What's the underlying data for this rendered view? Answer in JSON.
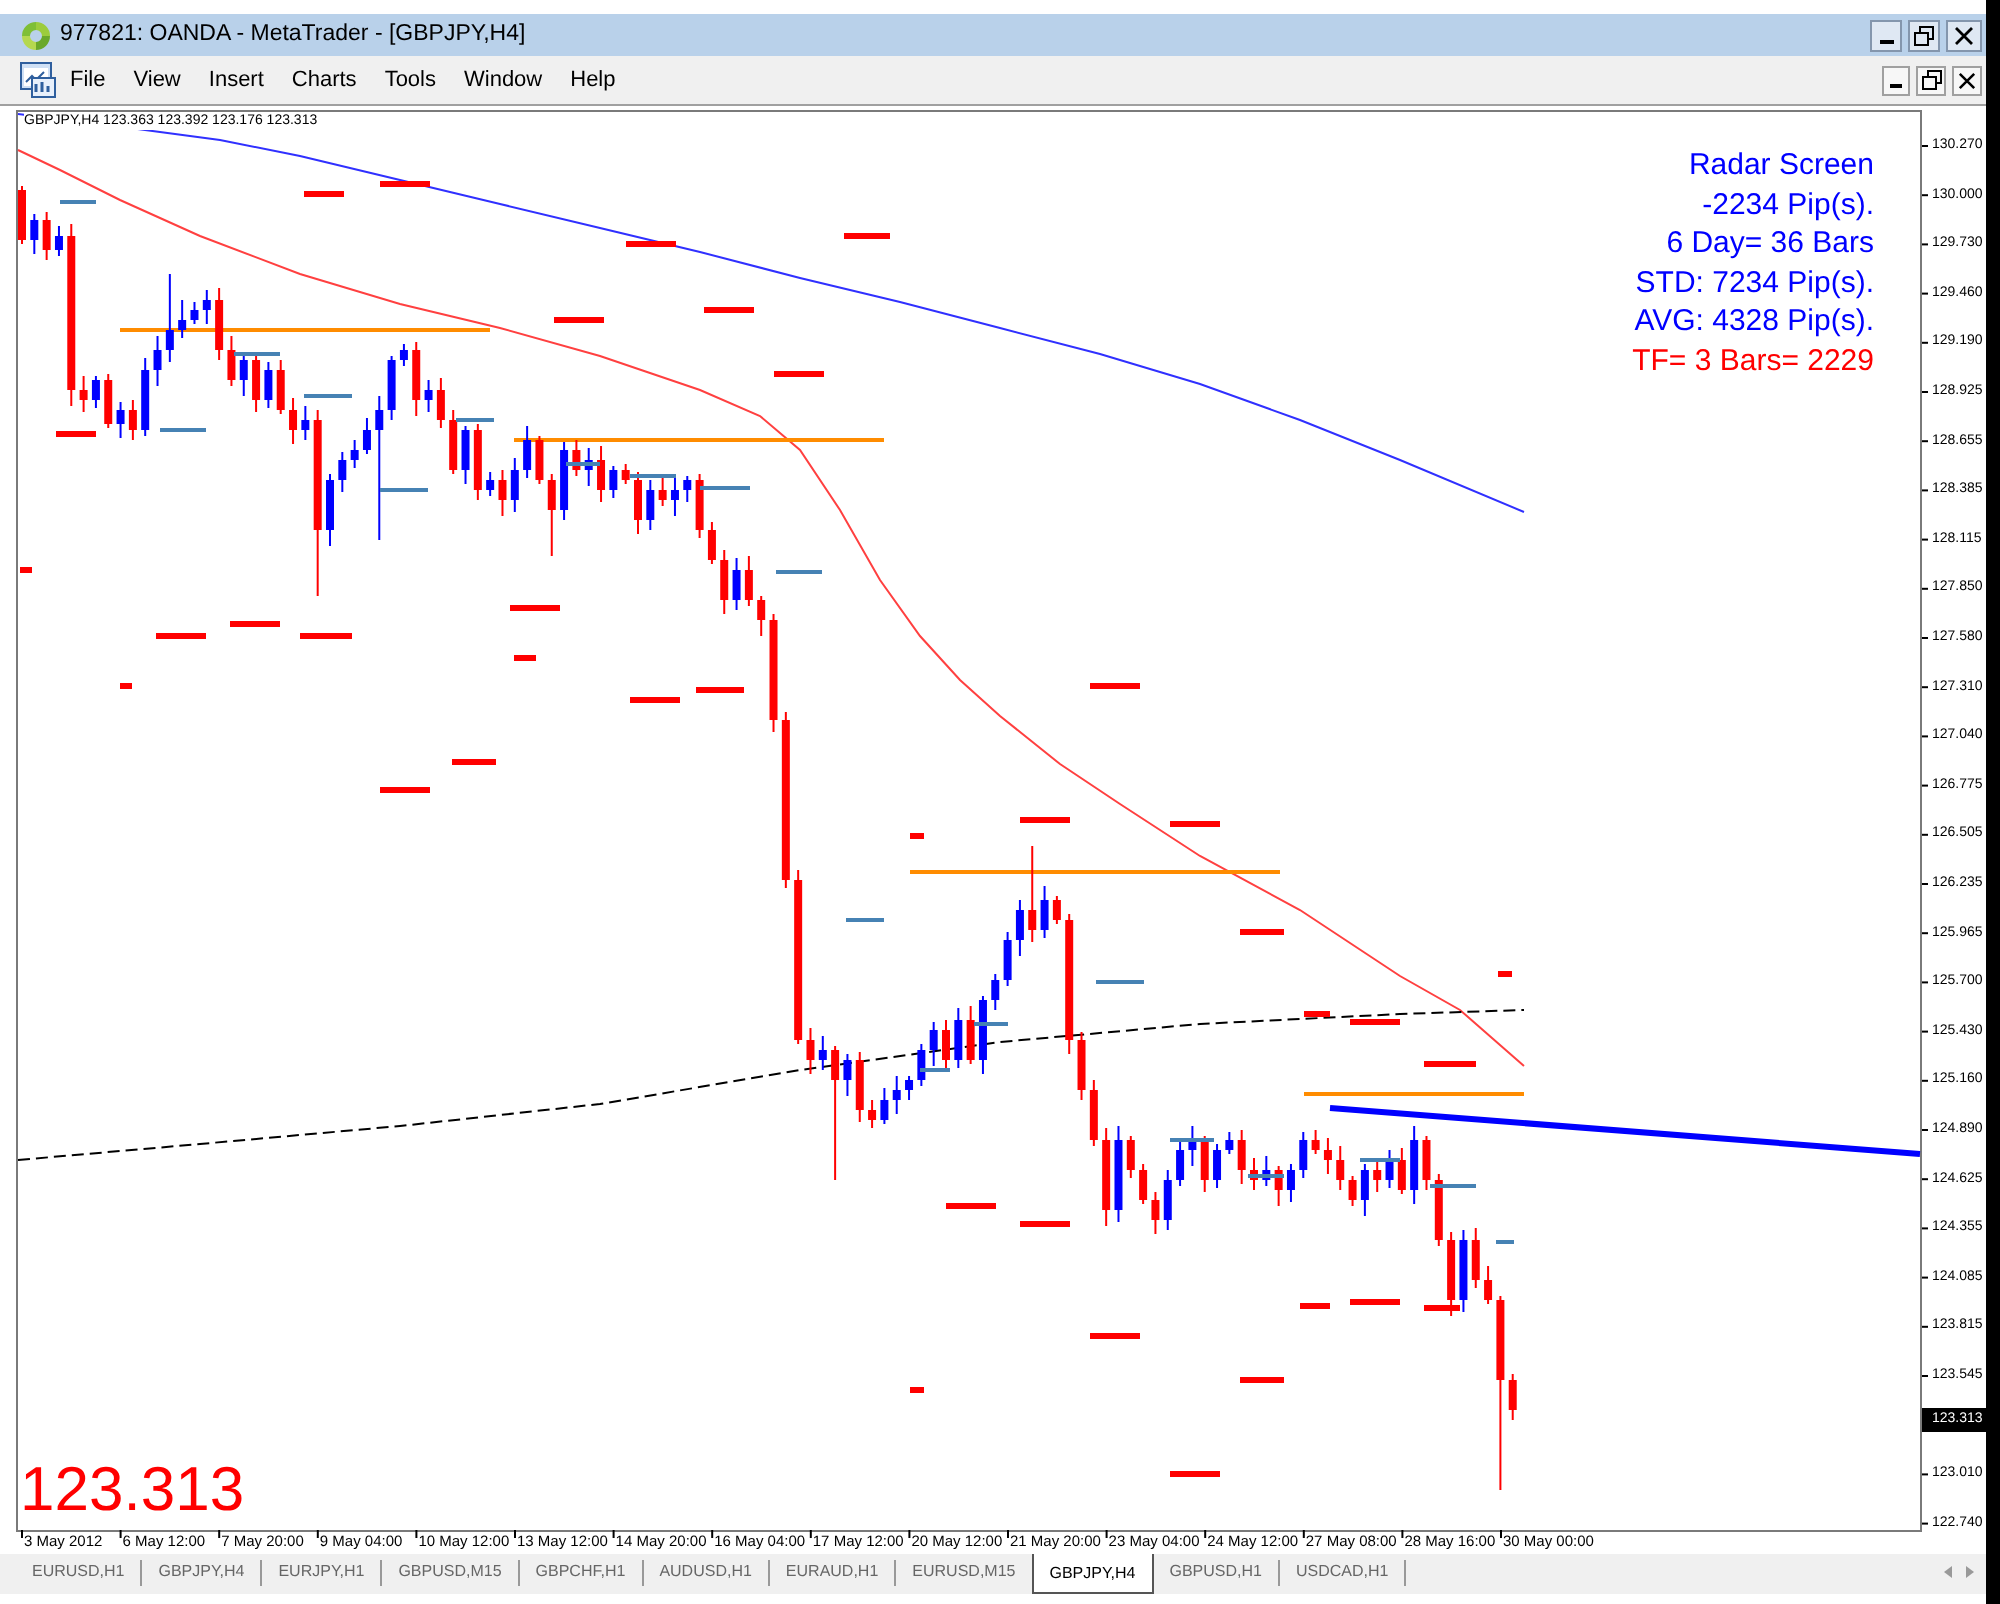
{
  "window": {
    "title": "977821: OANDA - MetaTrader - [GBPJPY,H4]"
  },
  "menu": [
    "File",
    "View",
    "Insert",
    "Charts",
    "Tools",
    "Window",
    "Help"
  ],
  "chart": {
    "symbol": "GBPJPY,H4",
    "quotes": [
      "123.363",
      "123.392",
      "123.176",
      "123.313"
    ],
    "radar": [
      {
        "text": "Radar Screen",
        "color": "#0000ff"
      },
      {
        "text": "-2234 Pip(s).",
        "color": "#0000ff"
      },
      {
        "text": "6 Day= 36 Bars",
        "color": "#0000ff"
      },
      {
        "text": "STD: 7234 Pip(s).",
        "color": "#0000ff"
      },
      {
        "text": "AVG: 4328 Pip(s).",
        "color": "#0000ff"
      },
      {
        "text": "TF= 3 Bars= 2229",
        "color": "#ff0000"
      }
    ],
    "price_readout": "123.313",
    "price_axis": [
      "130.270",
      "130.000",
      "129.730",
      "129.460",
      "129.190",
      "128.925",
      "128.655",
      "128.385",
      "128.115",
      "127.850",
      "127.580",
      "127.310",
      "127.040",
      "126.775",
      "126.505",
      "126.235",
      "125.965",
      "125.700",
      "125.430",
      "125.160",
      "124.890",
      "124.625",
      "124.355",
      "124.085",
      "123.815",
      "123.545",
      "123.010",
      "122.740"
    ],
    "current_price": "123.313",
    "time_axis": [
      "3 May 2012",
      "6 May 12:00",
      "7 May 20:00",
      "9 May 04:00",
      "10 May 12:00",
      "13 May 12:00",
      "14 May 20:00",
      "16 May 04:00",
      "17 May 12:00",
      "20 May 12:00",
      "21 May 20:00",
      "23 May 04:00",
      "24 May 12:00",
      "27 May 08:00",
      "28 May 16:00",
      "30 May 00:00"
    ]
  },
  "tabs": [
    {
      "label": "EURUSD,H1",
      "selected": false
    },
    {
      "label": "GBPJPY,H4",
      "selected": false
    },
    {
      "label": "EURJPY,H1",
      "selected": false
    },
    {
      "label": "GBPUSD,M15",
      "selected": false
    },
    {
      "label": "GBPCHF,H1",
      "selected": false
    },
    {
      "label": "AUDUSD,H1",
      "selected": false
    },
    {
      "label": "EURAUD,H1",
      "selected": false
    },
    {
      "label": "EURUSD,M15",
      "selected": false
    },
    {
      "label": "GBPJPY,H4",
      "selected": true
    },
    {
      "label": "GBPUSD,H1",
      "selected": false
    },
    {
      "label": "USDCAD,H1",
      "selected": false
    }
  ]
}
